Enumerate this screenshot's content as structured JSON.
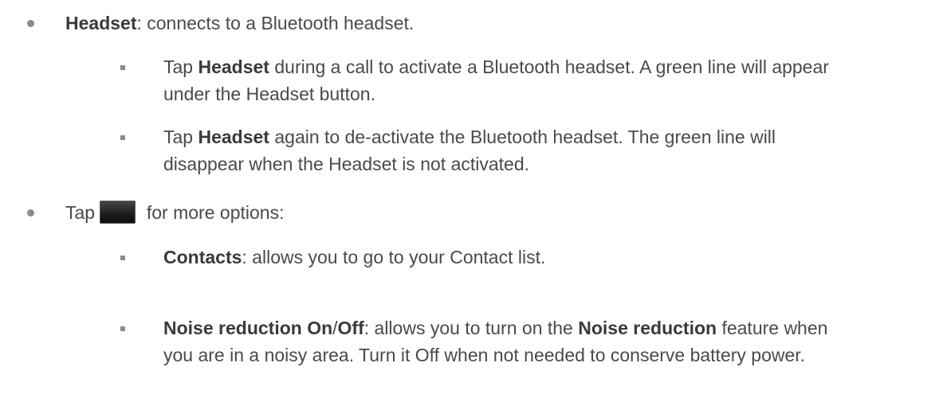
{
  "items": [
    {
      "bold": "Headset",
      "rest": ": connects to a Bluetooth headset.",
      "sub": [
        {
          "lead": "Tap ",
          "bold": "Headset",
          "line1": " during a call to activate a Bluetooth headset. A green line will appear",
          "line2": "under the Headset button."
        },
        {
          "lead": "Tap ",
          "bold": "Headset",
          "line1": " again to de-activate the Bluetooth headset. The green line will",
          "line2": "disappear when the Headset is not activated."
        }
      ]
    },
    {
      "lead": "Tap ",
      "icon": "menu-icon",
      "rest": " for more options:",
      "sub": [
        {
          "bold": "Contacts",
          "rest": ": allows you to go to your Contact list."
        },
        {
          "bold_a": "Noise reduction On",
          "sep": "/",
          "bold_b": "Off",
          "mid": ": allows you to turn on the ",
          "bold_c": "Noise reduction",
          "end": " feature when",
          "line2": "you are in a noisy area. Turn it Off when not needed to conserve battery power."
        }
      ]
    }
  ]
}
